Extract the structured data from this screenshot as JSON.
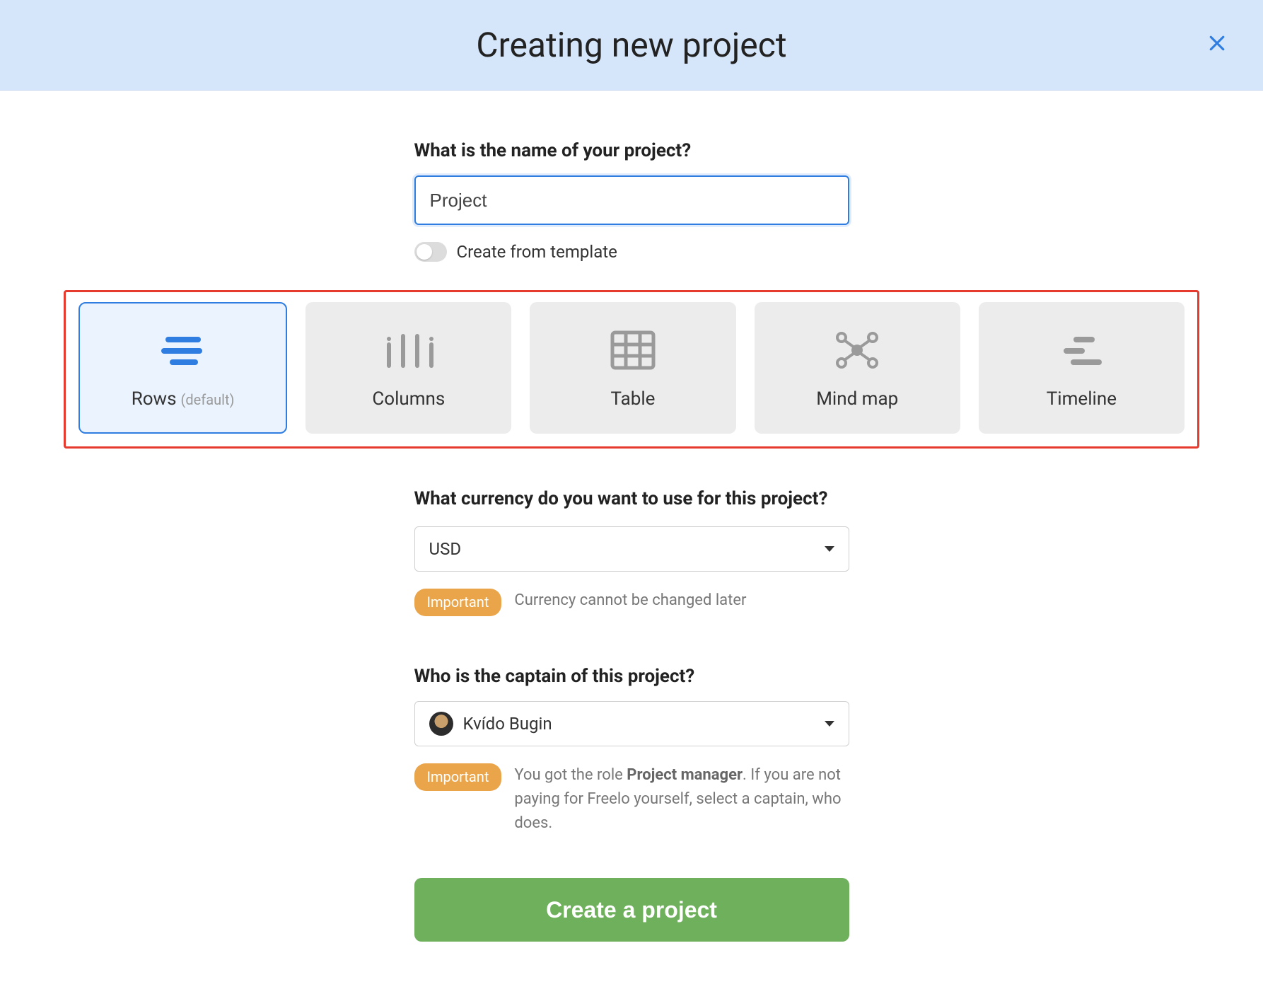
{
  "header": {
    "title": "Creating new project"
  },
  "name_section": {
    "label": "What is the name of your project?",
    "value": "Project",
    "template_toggle_label": "Create from template"
  },
  "views": [
    {
      "label": "Rows",
      "sub": "(default)",
      "selected": true
    },
    {
      "label": "Columns"
    },
    {
      "label": "Table"
    },
    {
      "label": "Mind map"
    },
    {
      "label": "Timeline"
    }
  ],
  "currency_section": {
    "label": "What currency do you want to use for this project?",
    "value": "USD",
    "badge": "Important",
    "note": "Currency cannot be changed later"
  },
  "captain_section": {
    "label": "Who is the captain of this project?",
    "value": "Kvído Bugin",
    "badge": "Important",
    "note_pre": "You got the role ",
    "note_bold": "Project manager",
    "note_post": ". If you are not paying for Freelo yourself, select a captain, who does."
  },
  "create_button": "Create a project"
}
